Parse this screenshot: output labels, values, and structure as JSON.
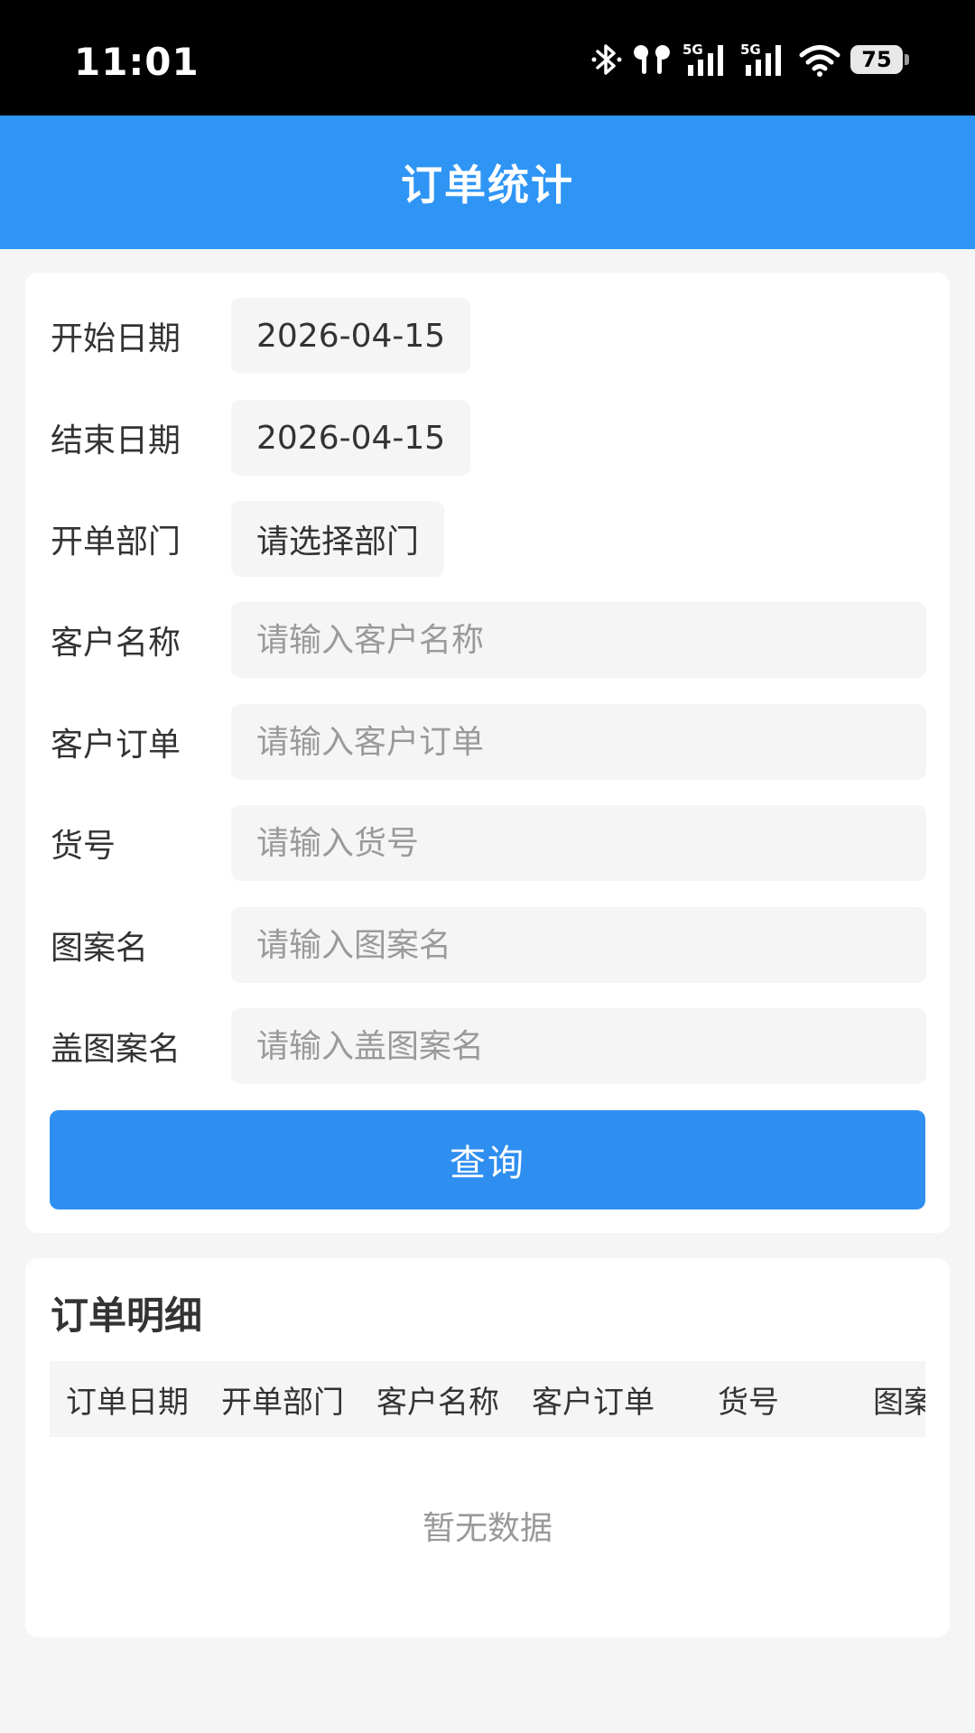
{
  "status_bar": {
    "time": "11:01",
    "battery": "75",
    "signal_label_1": "5G",
    "signal_label_2": "5G",
    "icons": [
      "bluetooth-icon",
      "earbuds-icon",
      "signal-5g-icon",
      "signal-5g-icon",
      "wifi-icon",
      "battery-icon"
    ]
  },
  "header": {
    "title": "订单统计"
  },
  "form": {
    "start_date": {
      "label": "开始日期",
      "value": "2026-04-15"
    },
    "end_date": {
      "label": "结束日期",
      "value": "2026-04-15"
    },
    "department": {
      "label": "开单部门",
      "value": "请选择部门"
    },
    "customer_name": {
      "label": "客户名称",
      "placeholder": "请输入客户名称"
    },
    "customer_order": {
      "label": "客户订单",
      "placeholder": "请输入客户订单"
    },
    "item_no": {
      "label": "货号",
      "placeholder": "请输入货号"
    },
    "pattern_name": {
      "label": "图案名",
      "placeholder": "请输入图案名"
    },
    "cover_pattern_name": {
      "label": "盖图案名",
      "placeholder": "请输入盖图案名"
    },
    "query_button": "查询"
  },
  "details": {
    "title": "订单明细",
    "columns": [
      "订单日期",
      "开单部门",
      "客户名称",
      "客户订单",
      "货号",
      "图案"
    ],
    "empty_text": "暂无数据"
  },
  "colors": {
    "primary": "#2f95f5",
    "button": "#2f8ff0",
    "background": "#f5f5f5",
    "field_background": "#f5f5f5",
    "placeholder": "#9a9a9a"
  }
}
